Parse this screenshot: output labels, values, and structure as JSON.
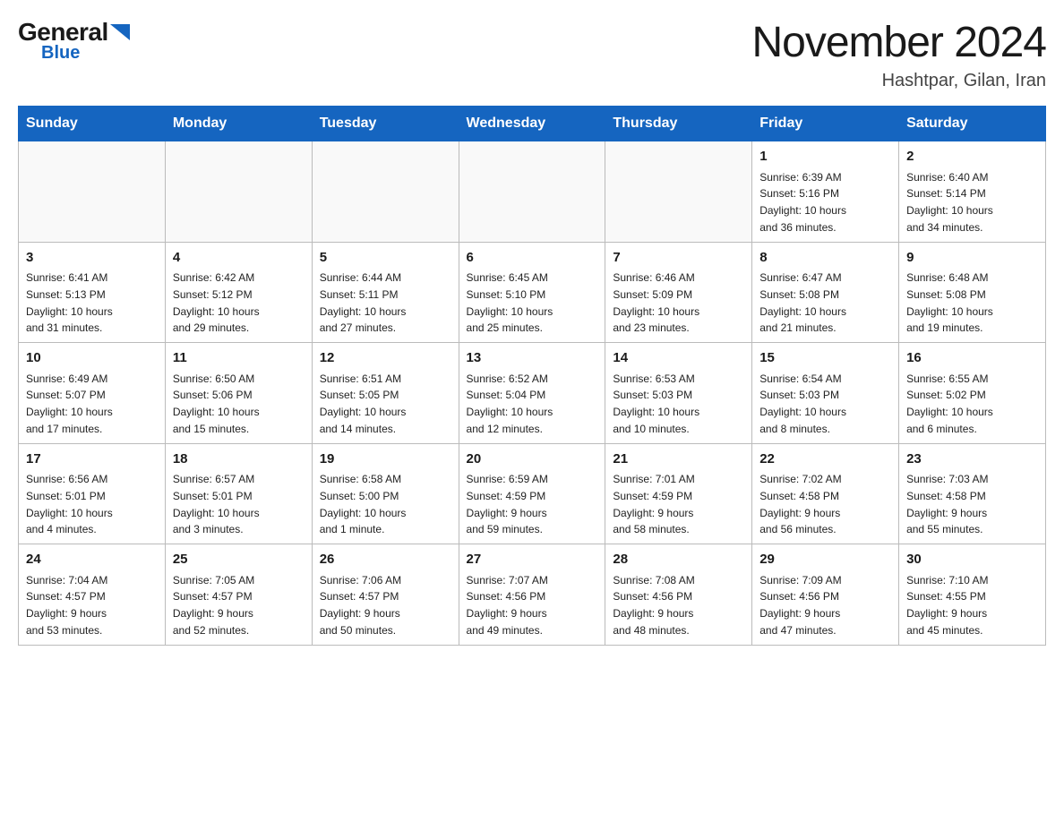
{
  "header": {
    "logo_general": "General",
    "logo_blue": "Blue",
    "month_title": "November 2024",
    "location": "Hashtpar, Gilan, Iran"
  },
  "days_of_week": [
    "Sunday",
    "Monday",
    "Tuesday",
    "Wednesday",
    "Thursday",
    "Friday",
    "Saturday"
  ],
  "weeks": [
    [
      {
        "day": "",
        "info": ""
      },
      {
        "day": "",
        "info": ""
      },
      {
        "day": "",
        "info": ""
      },
      {
        "day": "",
        "info": ""
      },
      {
        "day": "",
        "info": ""
      },
      {
        "day": "1",
        "info": "Sunrise: 6:39 AM\nSunset: 5:16 PM\nDaylight: 10 hours\nand 36 minutes."
      },
      {
        "day": "2",
        "info": "Sunrise: 6:40 AM\nSunset: 5:14 PM\nDaylight: 10 hours\nand 34 minutes."
      }
    ],
    [
      {
        "day": "3",
        "info": "Sunrise: 6:41 AM\nSunset: 5:13 PM\nDaylight: 10 hours\nand 31 minutes."
      },
      {
        "day": "4",
        "info": "Sunrise: 6:42 AM\nSunset: 5:12 PM\nDaylight: 10 hours\nand 29 minutes."
      },
      {
        "day": "5",
        "info": "Sunrise: 6:44 AM\nSunset: 5:11 PM\nDaylight: 10 hours\nand 27 minutes."
      },
      {
        "day": "6",
        "info": "Sunrise: 6:45 AM\nSunset: 5:10 PM\nDaylight: 10 hours\nand 25 minutes."
      },
      {
        "day": "7",
        "info": "Sunrise: 6:46 AM\nSunset: 5:09 PM\nDaylight: 10 hours\nand 23 minutes."
      },
      {
        "day": "8",
        "info": "Sunrise: 6:47 AM\nSunset: 5:08 PM\nDaylight: 10 hours\nand 21 minutes."
      },
      {
        "day": "9",
        "info": "Sunrise: 6:48 AM\nSunset: 5:08 PM\nDaylight: 10 hours\nand 19 minutes."
      }
    ],
    [
      {
        "day": "10",
        "info": "Sunrise: 6:49 AM\nSunset: 5:07 PM\nDaylight: 10 hours\nand 17 minutes."
      },
      {
        "day": "11",
        "info": "Sunrise: 6:50 AM\nSunset: 5:06 PM\nDaylight: 10 hours\nand 15 minutes."
      },
      {
        "day": "12",
        "info": "Sunrise: 6:51 AM\nSunset: 5:05 PM\nDaylight: 10 hours\nand 14 minutes."
      },
      {
        "day": "13",
        "info": "Sunrise: 6:52 AM\nSunset: 5:04 PM\nDaylight: 10 hours\nand 12 minutes."
      },
      {
        "day": "14",
        "info": "Sunrise: 6:53 AM\nSunset: 5:03 PM\nDaylight: 10 hours\nand 10 minutes."
      },
      {
        "day": "15",
        "info": "Sunrise: 6:54 AM\nSunset: 5:03 PM\nDaylight: 10 hours\nand 8 minutes."
      },
      {
        "day": "16",
        "info": "Sunrise: 6:55 AM\nSunset: 5:02 PM\nDaylight: 10 hours\nand 6 minutes."
      }
    ],
    [
      {
        "day": "17",
        "info": "Sunrise: 6:56 AM\nSunset: 5:01 PM\nDaylight: 10 hours\nand 4 minutes."
      },
      {
        "day": "18",
        "info": "Sunrise: 6:57 AM\nSunset: 5:01 PM\nDaylight: 10 hours\nand 3 minutes."
      },
      {
        "day": "19",
        "info": "Sunrise: 6:58 AM\nSunset: 5:00 PM\nDaylight: 10 hours\nand 1 minute."
      },
      {
        "day": "20",
        "info": "Sunrise: 6:59 AM\nSunset: 4:59 PM\nDaylight: 9 hours\nand 59 minutes."
      },
      {
        "day": "21",
        "info": "Sunrise: 7:01 AM\nSunset: 4:59 PM\nDaylight: 9 hours\nand 58 minutes."
      },
      {
        "day": "22",
        "info": "Sunrise: 7:02 AM\nSunset: 4:58 PM\nDaylight: 9 hours\nand 56 minutes."
      },
      {
        "day": "23",
        "info": "Sunrise: 7:03 AM\nSunset: 4:58 PM\nDaylight: 9 hours\nand 55 minutes."
      }
    ],
    [
      {
        "day": "24",
        "info": "Sunrise: 7:04 AM\nSunset: 4:57 PM\nDaylight: 9 hours\nand 53 minutes."
      },
      {
        "day": "25",
        "info": "Sunrise: 7:05 AM\nSunset: 4:57 PM\nDaylight: 9 hours\nand 52 minutes."
      },
      {
        "day": "26",
        "info": "Sunrise: 7:06 AM\nSunset: 4:57 PM\nDaylight: 9 hours\nand 50 minutes."
      },
      {
        "day": "27",
        "info": "Sunrise: 7:07 AM\nSunset: 4:56 PM\nDaylight: 9 hours\nand 49 minutes."
      },
      {
        "day": "28",
        "info": "Sunrise: 7:08 AM\nSunset: 4:56 PM\nDaylight: 9 hours\nand 48 minutes."
      },
      {
        "day": "29",
        "info": "Sunrise: 7:09 AM\nSunset: 4:56 PM\nDaylight: 9 hours\nand 47 minutes."
      },
      {
        "day": "30",
        "info": "Sunrise: 7:10 AM\nSunset: 4:55 PM\nDaylight: 9 hours\nand 45 minutes."
      }
    ]
  ]
}
